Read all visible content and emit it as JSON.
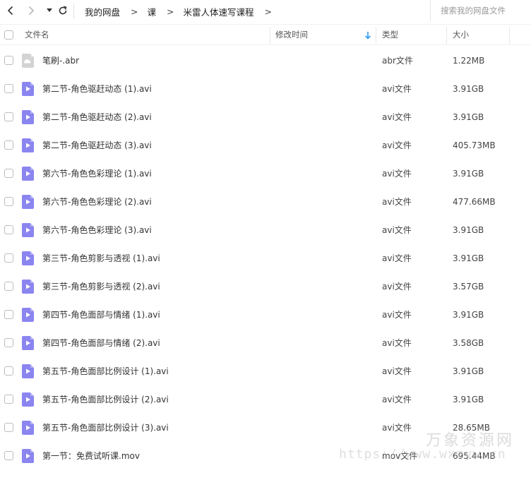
{
  "nav": {
    "breadcrumb": [
      "我的网盘",
      "课",
      "米雷人体速写课程"
    ],
    "breadcrumb_sep": ">",
    "search_placeholder": "搜索我的网盘文件"
  },
  "table": {
    "headers": {
      "name": "文件名",
      "mtime": "修改时间",
      "type": "类型",
      "size": "大小"
    },
    "rows": [
      {
        "name": "笔刷-.abr",
        "type": "abr文件",
        "size": "1.22MB",
        "icon": "cloud-file-icon"
      },
      {
        "name": "第二节-角色驱赶动态 (1).avi",
        "type": "avi文件",
        "size": "3.91GB",
        "icon": "video-file-icon"
      },
      {
        "name": "第二节-角色驱赶动态 (2).avi",
        "type": "avi文件",
        "size": "3.91GB",
        "icon": "video-file-icon"
      },
      {
        "name": "第二节-角色驱赶动态 (3).avi",
        "type": "avi文件",
        "size": "405.73MB",
        "icon": "video-file-icon"
      },
      {
        "name": "第六节-角色色彩理论 (1).avi",
        "type": "avi文件",
        "size": "3.91GB",
        "icon": "video-file-icon"
      },
      {
        "name": "第六节-角色色彩理论 (2).avi",
        "type": "avi文件",
        "size": "477.66MB",
        "icon": "video-file-icon"
      },
      {
        "name": "第六节-角色色彩理论 (3).avi",
        "type": "avi文件",
        "size": "3.91GB",
        "icon": "video-file-icon"
      },
      {
        "name": "第三节-角色剪影与透视 (1).avi",
        "type": "avi文件",
        "size": "3.91GB",
        "icon": "video-file-icon"
      },
      {
        "name": "第三节-角色剪影与透视 (2).avi",
        "type": "avi文件",
        "size": "3.57GB",
        "icon": "video-file-icon"
      },
      {
        "name": "第四节-角色面部与情绪 (1).avi",
        "type": "avi文件",
        "size": "3.91GB",
        "icon": "video-file-icon"
      },
      {
        "name": "第四节-角色面部与情绪 (2).avi",
        "type": "avi文件",
        "size": "3.58GB",
        "icon": "video-file-icon"
      },
      {
        "name": "第五节-角色面部比例设计 (1).avi",
        "type": "avi文件",
        "size": "3.91GB",
        "icon": "video-file-icon"
      },
      {
        "name": "第五节-角色面部比例设计 (2).avi",
        "type": "avi文件",
        "size": "3.91GB",
        "icon": "video-file-icon"
      },
      {
        "name": "第五节-角色面部比例设计 (3).avi",
        "type": "avi文件",
        "size": "28.65MB",
        "icon": "video-file-icon"
      },
      {
        "name": "第一节：免费试听课.mov",
        "type": "mov文件",
        "size": "695.44MB",
        "icon": "video-file-icon"
      }
    ]
  },
  "watermark": {
    "main": "万象资源网",
    "url": "https://www.wxzyw.cn"
  },
  "colors": {
    "video_icon": "#8b85f0",
    "cloud_icon": "#d3d3d3",
    "sort_arrow": "#2a9bf0"
  }
}
